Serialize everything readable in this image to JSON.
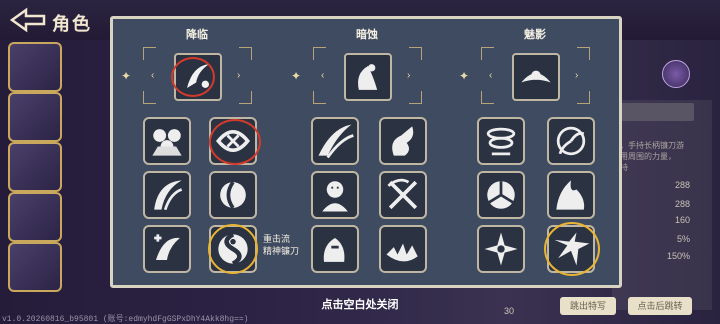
{
  "header": {
    "title": "角色"
  },
  "dialog": {
    "columns": [
      {
        "title": "降临"
      },
      {
        "title": "暗蚀"
      },
      {
        "title": "魅影"
      }
    ],
    "selected_skill_label": "重击流\n精神镰刀",
    "close_hint": "点击空白处关闭"
  },
  "right_panel": {
    "desc_lines": [
      "，手持长柄镰刀游",
      "用周围的力量，",
      "持"
    ],
    "stats": [
      "288",
      "288",
      "160",
      "5%",
      "150%"
    ],
    "button_left": "跳出特写",
    "button_right": "点击后跳转"
  },
  "version_text": "v1.0.20260816_b95801 (账号:edmyhdFgGSPxDhY4Akk8hg==)",
  "page_number": "30",
  "colors": {
    "dialog_bg": "#3f4b60",
    "dialog_border": "#d9d3c3",
    "highlight_red": "#d23b2b",
    "highlight_yellow": "#e8b432"
  }
}
